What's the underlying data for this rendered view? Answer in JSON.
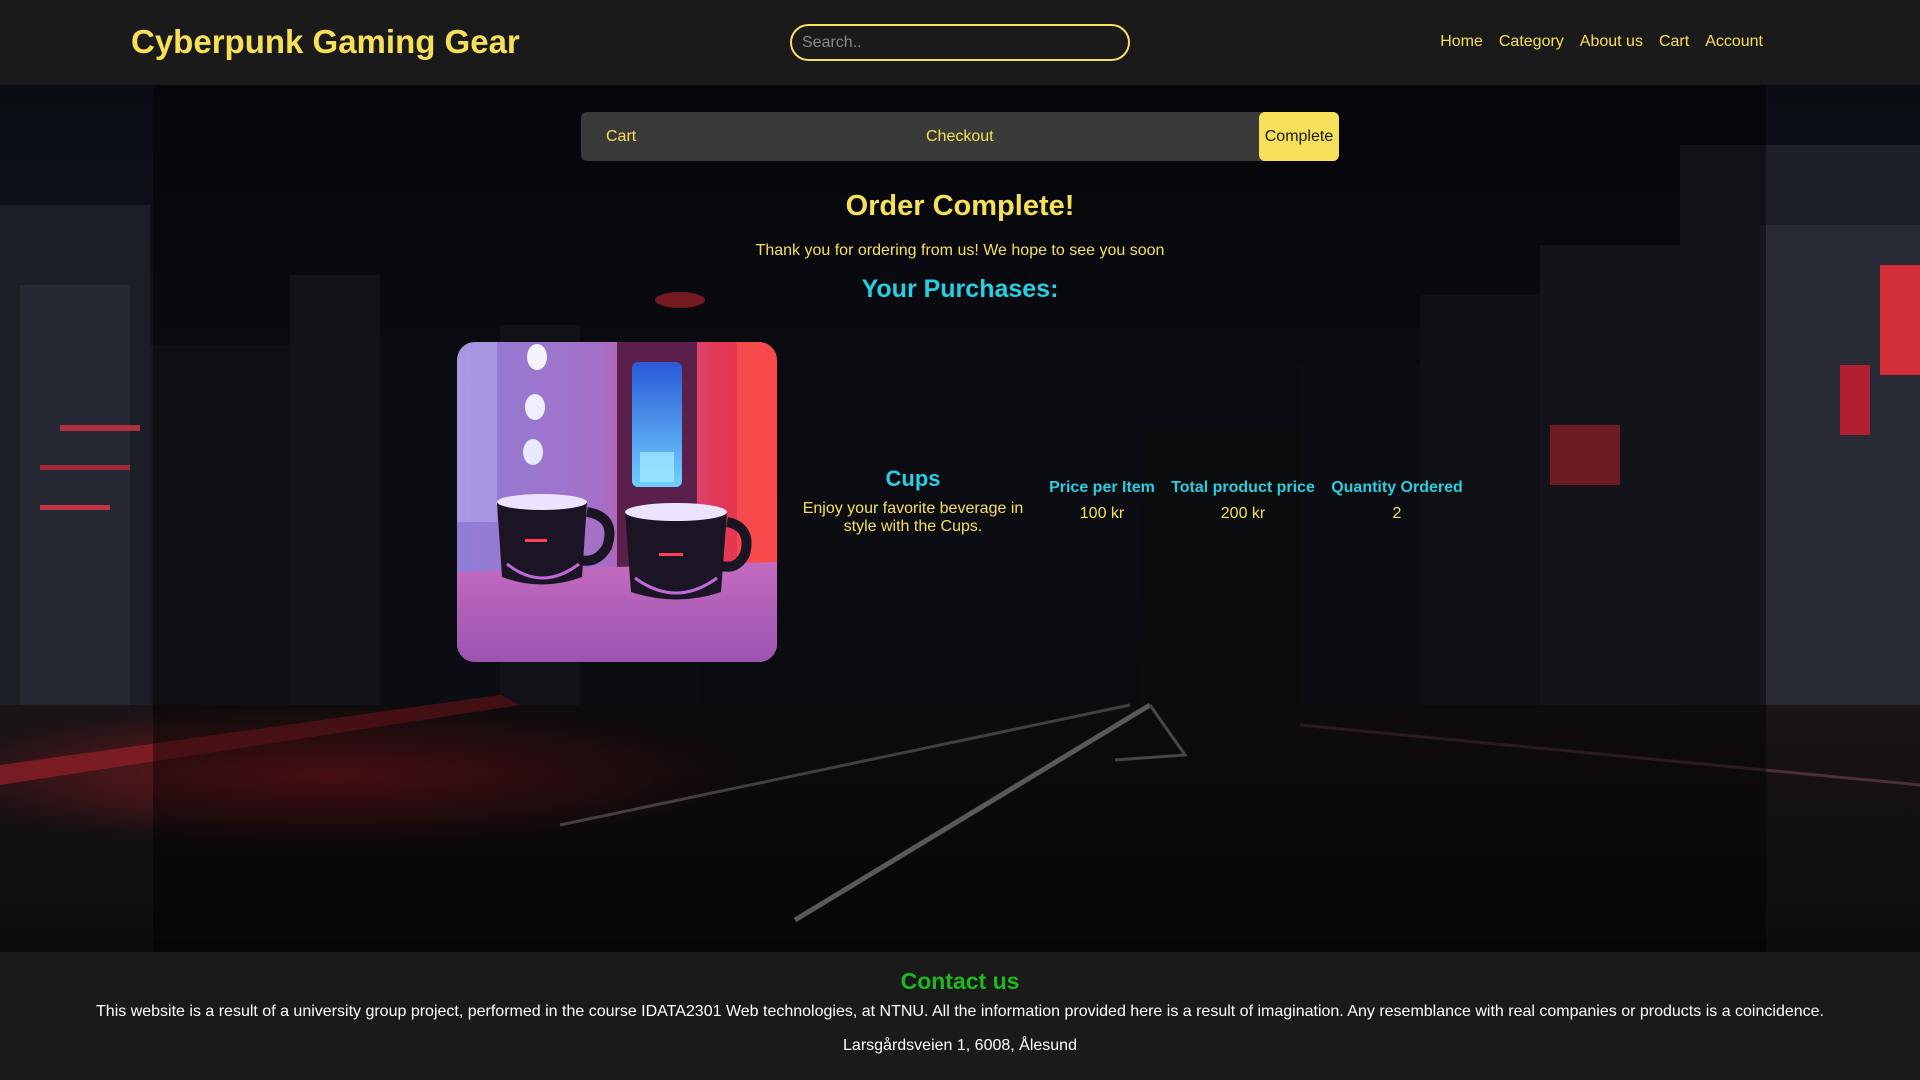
{
  "header": {
    "site_title": "Cyberpunk Gaming Gear",
    "search_placeholder": "Search..",
    "nav": [
      "Home",
      "Category",
      "About us",
      "Cart",
      "Account"
    ]
  },
  "steps": {
    "cart": "Cart",
    "checkout": "Checkout",
    "complete": "Complete",
    "active": "Complete"
  },
  "main": {
    "order_title": "Order Complete!",
    "thanks": "Thank you for ordering from us! We hope to see you soon",
    "purchases_title": "Your Purchases:",
    "columns": {
      "price_per_item": "Price per Item",
      "total_price": "Total product price",
      "quantity": "Quantity Ordered"
    },
    "items": [
      {
        "name": "Cups",
        "description": "Enjoy your favorite beverage in style with the Cups.",
        "price_per_item": "100 kr",
        "total_price": "200 kr",
        "quantity": "2",
        "image_icon": "cyberpunk-cups-image"
      }
    ]
  },
  "footer": {
    "contact_title": "Contact us",
    "text": "This website is a result of a university group project, performed in the course IDATA2301 Web technologies, at NTNU. All the information provided here is a result of imagination. Any resemblance with real companies or products is a coincidence.",
    "address": "Larsgårdsveien 1, 6008, Ålesund"
  },
  "colors": {
    "accent_yellow": "#f6e05a",
    "accent_cyan": "#27cfe0",
    "contact_green": "#1fb81f",
    "bar_bg": "#1a1a1a"
  }
}
